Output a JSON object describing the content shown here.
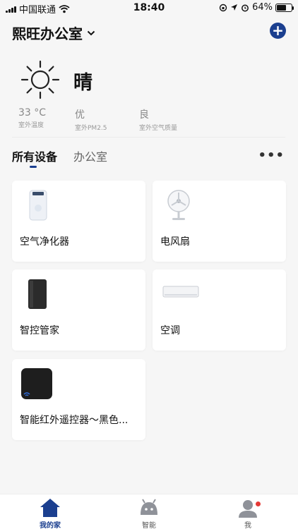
{
  "status_bar": {
    "carrier": "中国联通",
    "time": "18:40",
    "battery": "64%",
    "battery_level": 0.64
  },
  "header": {
    "home_name": "熙旺办公室",
    "add_icon": "plus-circle-icon"
  },
  "weather": {
    "condition": "晴",
    "icon": "sun-icon",
    "stats": [
      {
        "value": "33 °C",
        "label": "室外温度"
      },
      {
        "value": "优",
        "label": "室外PM2.5"
      },
      {
        "value": "良",
        "label": "室外空气质量"
      }
    ]
  },
  "tabs": [
    {
      "label": "所有设备",
      "active": true
    },
    {
      "label": "办公室",
      "active": false
    }
  ],
  "devices": [
    {
      "name": "空气净化器",
      "icon": "air-purifier-icon"
    },
    {
      "name": "电风扇",
      "icon": "electric-fan-icon"
    },
    {
      "name": "智控管家",
      "icon": "smart-hub-icon"
    },
    {
      "name": "空调",
      "icon": "air-conditioner-icon"
    },
    {
      "name": "智能红外遥控器～黑色...",
      "icon": "ir-remote-icon"
    }
  ],
  "bottom_nav": [
    {
      "label": "我的家",
      "icon": "home-icon",
      "active": true
    },
    {
      "label": "智能",
      "icon": "robot-icon",
      "active": false
    },
    {
      "label": "我",
      "icon": "user-icon",
      "active": false,
      "badge": true
    }
  ],
  "colors": {
    "accent": "#1b3f8f",
    "badge": "#e53935",
    "background": "#f6f6f6"
  }
}
